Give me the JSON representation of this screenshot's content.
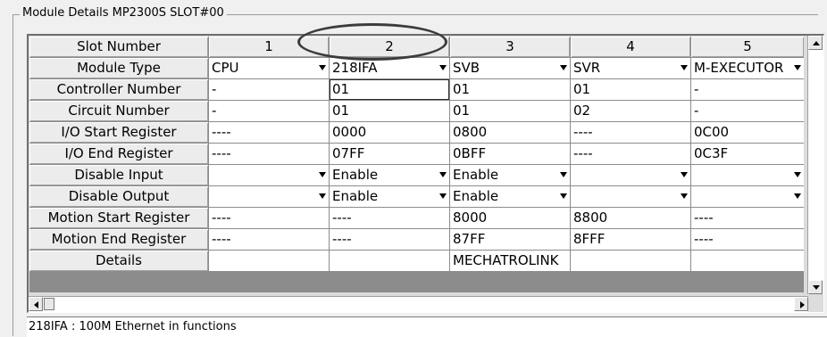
{
  "group": {
    "title": "Module Details  MP2300S  SLOT#00"
  },
  "grid": {
    "corner_label": "Slot Number",
    "columns": [
      "1",
      "2",
      "3",
      "4",
      "5"
    ],
    "rows": [
      {
        "label": "Module Type",
        "cells": [
          "CPU",
          "218IFA",
          "SVB",
          "SVR",
          "M-EXECUTOR"
        ]
      },
      {
        "label": "Controller Number",
        "cells": [
          "-",
          "01",
          "01",
          "01",
          "-"
        ]
      },
      {
        "label": "Circuit Number",
        "cells": [
          "-",
          "01",
          "01",
          "02",
          "-"
        ]
      },
      {
        "label": "I/O Start Register",
        "cells": [
          "----",
          "0000",
          "0800",
          "----",
          "0C00"
        ]
      },
      {
        "label": "I/O End Register",
        "cells": [
          "----",
          "07FF",
          "0BFF",
          "----",
          "0C3F"
        ]
      },
      {
        "label": "Disable Input",
        "cells": [
          "",
          "Enable",
          "Enable",
          "",
          ""
        ]
      },
      {
        "label": "Disable Output",
        "cells": [
          "",
          "Enable",
          "Enable",
          "",
          ""
        ]
      },
      {
        "label": "Motion Start Register",
        "cells": [
          "----",
          "----",
          "8000",
          "8800",
          "----"
        ]
      },
      {
        "label": "Motion End Register",
        "cells": [
          "----",
          "----",
          "87FF",
          "8FFF",
          "----"
        ]
      },
      {
        "label": "Details",
        "cells": [
          "",
          "",
          "MECHATROLINK",
          "",
          ""
        ]
      }
    ]
  },
  "status": {
    "text": "218IFA : 100M Ethernet in functions"
  },
  "icons": {
    "combo": "chevron-down-icon",
    "scroll_up": "arrow-up-icon",
    "scroll_down": "arrow-down-icon",
    "scroll_left": "arrow-left-icon",
    "scroll_right": "arrow-right-icon"
  }
}
